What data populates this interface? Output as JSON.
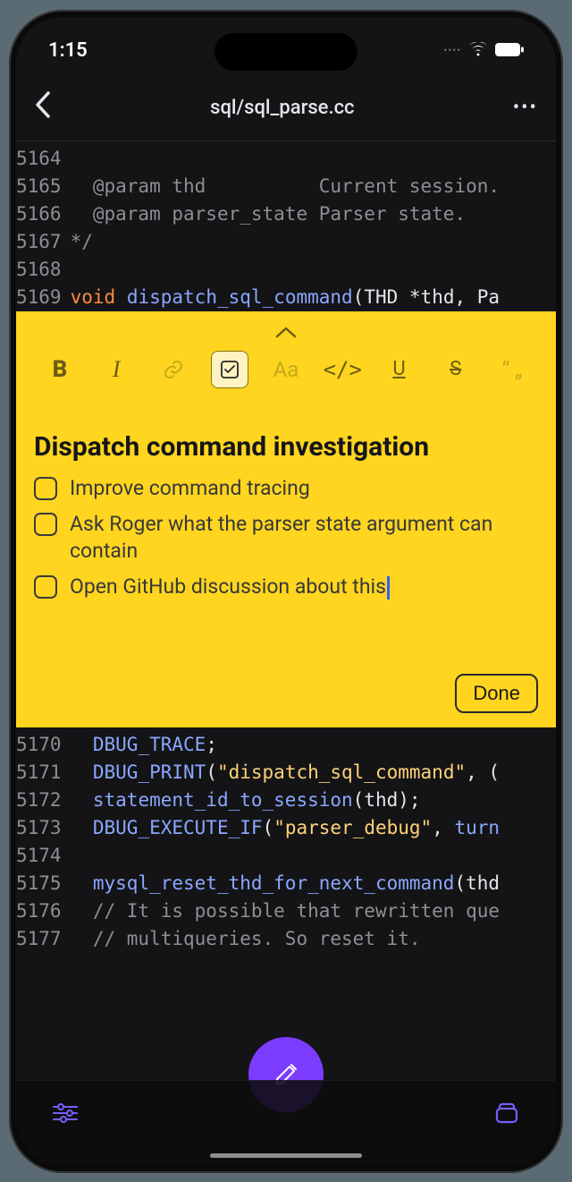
{
  "status": {
    "time": "1:15"
  },
  "header": {
    "title": "sql/sql_parse.cc"
  },
  "code": {
    "top": [
      {
        "n": "5164",
        "html": "<span class='tok-comment'></span>"
      },
      {
        "n": "5165",
        "html": "<span class='tok-comment'>  @param thd          Current session.</span>"
      },
      {
        "n": "5166",
        "html": "<span class='tok-comment'>  @param parser_state Parser state.</span>"
      },
      {
        "n": "5167",
        "html": "<span class='tok-comment'>*/</span>"
      },
      {
        "n": "5168",
        "html": ""
      },
      {
        "n": "5169",
        "html": "<span class='tok-kw'>void</span> <span class='tok-id'>dispatch_sql_command</span><span class='tok-plain'>(THD *thd, Pa</span>"
      }
    ],
    "bottom": [
      {
        "n": "5170",
        "html": "<span class='tok-plain'>  </span><span class='tok-id'>DBUG_TRACE</span><span class='tok-plain'>;</span>"
      },
      {
        "n": "5171",
        "html": "<span class='tok-plain'>  </span><span class='tok-id'>DBUG_PRINT</span><span class='tok-plain'>(</span><span class='tok-str'>\"dispatch_sql_command\"</span><span class='tok-plain'>, (</span>"
      },
      {
        "n": "5172",
        "html": "<span class='tok-plain'>  </span><span class='tok-id'>statement_id_to_session</span><span class='tok-plain'>(thd);</span>"
      },
      {
        "n": "5173",
        "html": "<span class='tok-plain'>  </span><span class='tok-id'>DBUG_EXECUTE_IF</span><span class='tok-plain'>(</span><span class='tok-str'>\"parser_debug\"</span><span class='tok-plain'>, </span><span class='tok-id'>turn</span>"
      },
      {
        "n": "5174",
        "html": ""
      },
      {
        "n": "5175",
        "html": "<span class='tok-plain'>  </span><span class='tok-id'>mysql_reset_thd_for_next_command</span><span class='tok-plain'>(thd</span>"
      },
      {
        "n": "5176",
        "html": "<span class='tok-comment'>  // It is possible that rewritten que</span>"
      },
      {
        "n": "5177",
        "html": "<span class='tok-comment'>  // multiqueries. So reset it.</span>"
      }
    ]
  },
  "note": {
    "title": "Dispatch command investigation",
    "tasks": [
      "Improve command tracing",
      "Ask Roger what the parser state argument can contain",
      "Open GitHub discussion about this"
    ],
    "done_label": "Done"
  },
  "format": {
    "bold": "B",
    "italic": "I",
    "aa": "Aa",
    "code": "</>",
    "underline": "U",
    "strike": "S",
    "quote": "“ „"
  }
}
